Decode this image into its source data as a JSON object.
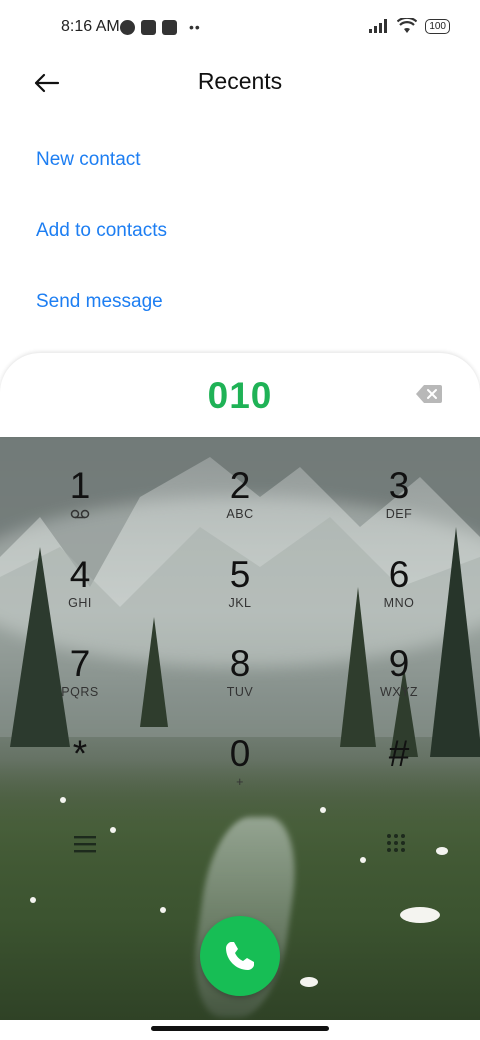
{
  "status_bar": {
    "time": "8:16 AM",
    "battery": "100",
    "icons": [
      "notification-icon",
      "app-icon",
      "upload-icon",
      "more-dots-icon",
      "signal-icon",
      "wifi-icon",
      "battery-icon"
    ]
  },
  "header": {
    "title": "Recents",
    "back_icon": "arrow-left-icon"
  },
  "actions": [
    "New contact",
    "Add to contacts",
    "Send message"
  ],
  "dialer": {
    "number": "010",
    "backspace_icon": "backspace-icon"
  },
  "keypad": [
    {
      "digit": "1",
      "letters": ""
    },
    {
      "digit": "2",
      "letters": "ABC"
    },
    {
      "digit": "3",
      "letters": "DEF"
    },
    {
      "digit": "4",
      "letters": "GHI"
    },
    {
      "digit": "5",
      "letters": "JKL"
    },
    {
      "digit": "6",
      "letters": "MNO"
    },
    {
      "digit": "7",
      "letters": "PQRS"
    },
    {
      "digit": "8",
      "letters": "TUV"
    },
    {
      "digit": "9",
      "letters": "WXYZ"
    },
    {
      "digit": "*",
      "letters": ""
    },
    {
      "digit": "0",
      "letters": "+"
    },
    {
      "digit": "#",
      "letters": ""
    }
  ],
  "colors": {
    "accent_blue": "#1d7ef2",
    "number_green": "#1fb256",
    "call_green": "#17be55"
  }
}
